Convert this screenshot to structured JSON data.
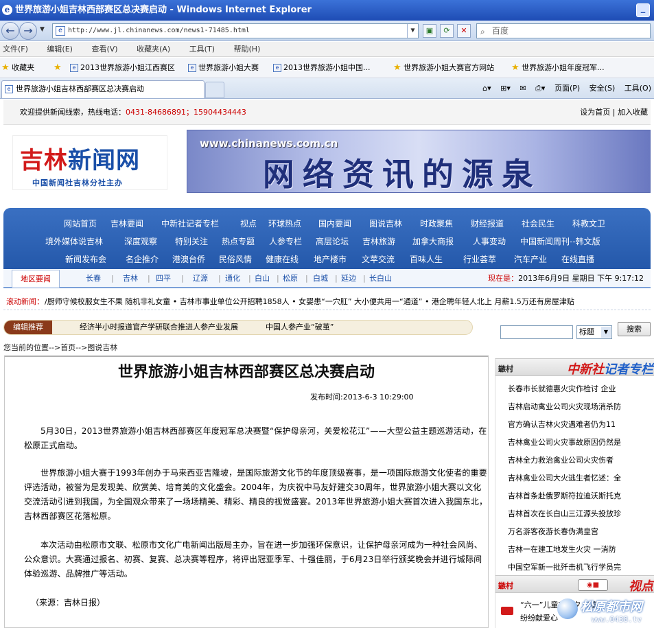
{
  "browser": {
    "title": "世界旅游小姐吉林西部赛区总决赛启动 - Windows Internet Explorer",
    "address": "http://www.jl.chinanews.com/news1-71485.html",
    "search_placeholder": "百度",
    "menu": [
      "文件(F)",
      "编辑(E)",
      "查看(V)",
      "收藏夹(A)",
      "工具(T)",
      "帮助(H)"
    ],
    "favorites_label": "收藏夹",
    "favorites": [
      "2013世界旅游小姐江西赛区",
      "世界旅游小姐大赛",
      "2013世界旅游小姐中国...",
      "世界旅游小姐大赛官方网站",
      "世界旅游小姐年度冠军..."
    ],
    "tab_label": "世界旅游小姐吉林西部赛区总决赛启动",
    "cmd": {
      "page": "页面(P)",
      "safety": "安全(S)",
      "tools": "工具(O)"
    }
  },
  "site": {
    "welcome": "欢迎提供新闻线索，热线电话：",
    "hotline": "0431-84686891；15904434443",
    "set_home": "设为首页",
    "sep": "|",
    "add_fav": "加入收藏",
    "logo_red": "吉林",
    "logo_blue": "新闻网",
    "logo_sub": "中国新闻社吉林分社主办",
    "banner_url": "www.chinanews.com.cn",
    "banner_slogan": "网络资讯的源泉"
  },
  "nav": {
    "row1": [
      "网站首页",
      "吉林要闻",
      "中新社记者专栏",
      "视点",
      "环球热点",
      "国内要闻",
      "图说吉林",
      "时政聚焦",
      "财经报道",
      "社会民生",
      "科教文卫"
    ],
    "row2": [
      "境外媒体说吉林",
      "深度观察",
      "特别关注",
      "热点专题",
      "人参专栏",
      "高层论坛",
      "吉林旅游",
      "加拿大商报",
      "人事变动",
      "中国新闻周刊--韩文版"
    ],
    "row3": [
      "新闻发布会",
      "名企推介",
      "港澳台侨",
      "民俗风情",
      "健康在线",
      "地产楼市",
      "文苹交流",
      "百味人生",
      "行业荟萃",
      "汽车产业",
      "在线直播"
    ]
  },
  "districts": {
    "tab": "地区要闻",
    "items": [
      "长春",
      "吉林",
      "四平",
      "辽源",
      "通化",
      "白山",
      "松原",
      "白城",
      "延边",
      "长白山"
    ],
    "now_label": "现在是：",
    "now_value": "2013年6月9日 星期日 下午 9:17:12"
  },
  "ticker": {
    "label": "滚动新闻：",
    "text": "/厨师守候校服女生不果 随机非礼女童 • 吉林市事业单位公开招聘1858人 • 女婴患“一穴肛” 大小便共用一“通道” • 港企聘年轻人北上 月薪1.5万还有房屋津贴"
  },
  "editor_pick": {
    "label": "编辑推荐",
    "items": [
      "经济半小时报道官产学研联合推进人参产业发展",
      "中国人参产业“破茧”"
    ]
  },
  "searchbox": {
    "select": "标题",
    "button": "搜索"
  },
  "breadcrumb": "您当前的位置-->首页-->图说吉林",
  "article": {
    "title": "世界旅游小姐吉林西部赛区总决赛启动",
    "date": "发布时间:2013-6-3 10:29:00",
    "paragraphs": [
      "5月30日，2013世界旅游小姐吉林西部赛区年度冠军总决赛暨“保护母亲河，关爱松花江”——大型公益主题巡游活动，在松原正式启动。",
      "世界旅游小姐大赛于1993年创办于马来西亚吉隆坡，是国际旅游文化节的年度顶级赛事，是一项国际旅游文化使者的重要评选活动，被誉为是发现美、欣赏美、培育美的文化盛会。2004年，为庆祝中马友好建交30周年，世界旅游小姐大赛以文化交流活动引进到我国，为全国观众带来了一场场精美、精彩、精良的视觉盛宴。2013年世界旅游小姐大赛首次进入我国东北，吉林西部赛区花落松原。",
      "本次活动由松原市文联、松原市文化广电新闻出版局主办，旨在进一步加强环保意识，让保护母亲河成为一种社会风尚、公众意识。大赛通过报名、初赛、复赛、总决赛等程序，将评出冠亚季军、十强佳丽，于6月23日举行颁奖晚会并进行城际间体验巡游、品牌推广等活动。"
    ],
    "source": "（来源：吉林日报）"
  },
  "sidebar": {
    "head1_label": "鏃村",
    "head1_brand_red": "中新社",
    "head1_brand_blue": "记者专栏",
    "items": [
      "长春市长就德惠火灾作检讨 企业",
      "吉林启动禽业公司火灾现场消杀防",
      "官方确认吉林火灾遇难者仍为11",
      "吉林禽业公司火灾事故原因仍然是",
      "吉林全力救治禽业公司火灾伤者",
      "吉林禽业公司大火逃生者忆述：全",
      "吉林首条赴俄罗斯符拉迪沃斯托克",
      "吉林首次在长白山三江源头投放珍",
      "万名游客夜游长春伪满皇宫",
      "吉林一在建工地发生火灾 一消防",
      "中国空军新一批歼击机飞行学员完"
    ],
    "head2_label": "鏃村",
    "head2_brand": "视点",
    "video_lines": [
      "“六一”儿童节前夕 长春",
      "纷纷献爱心"
    ]
  },
  "watermark": {
    "text": "松原都市网",
    "url": "www.0438.tv"
  }
}
